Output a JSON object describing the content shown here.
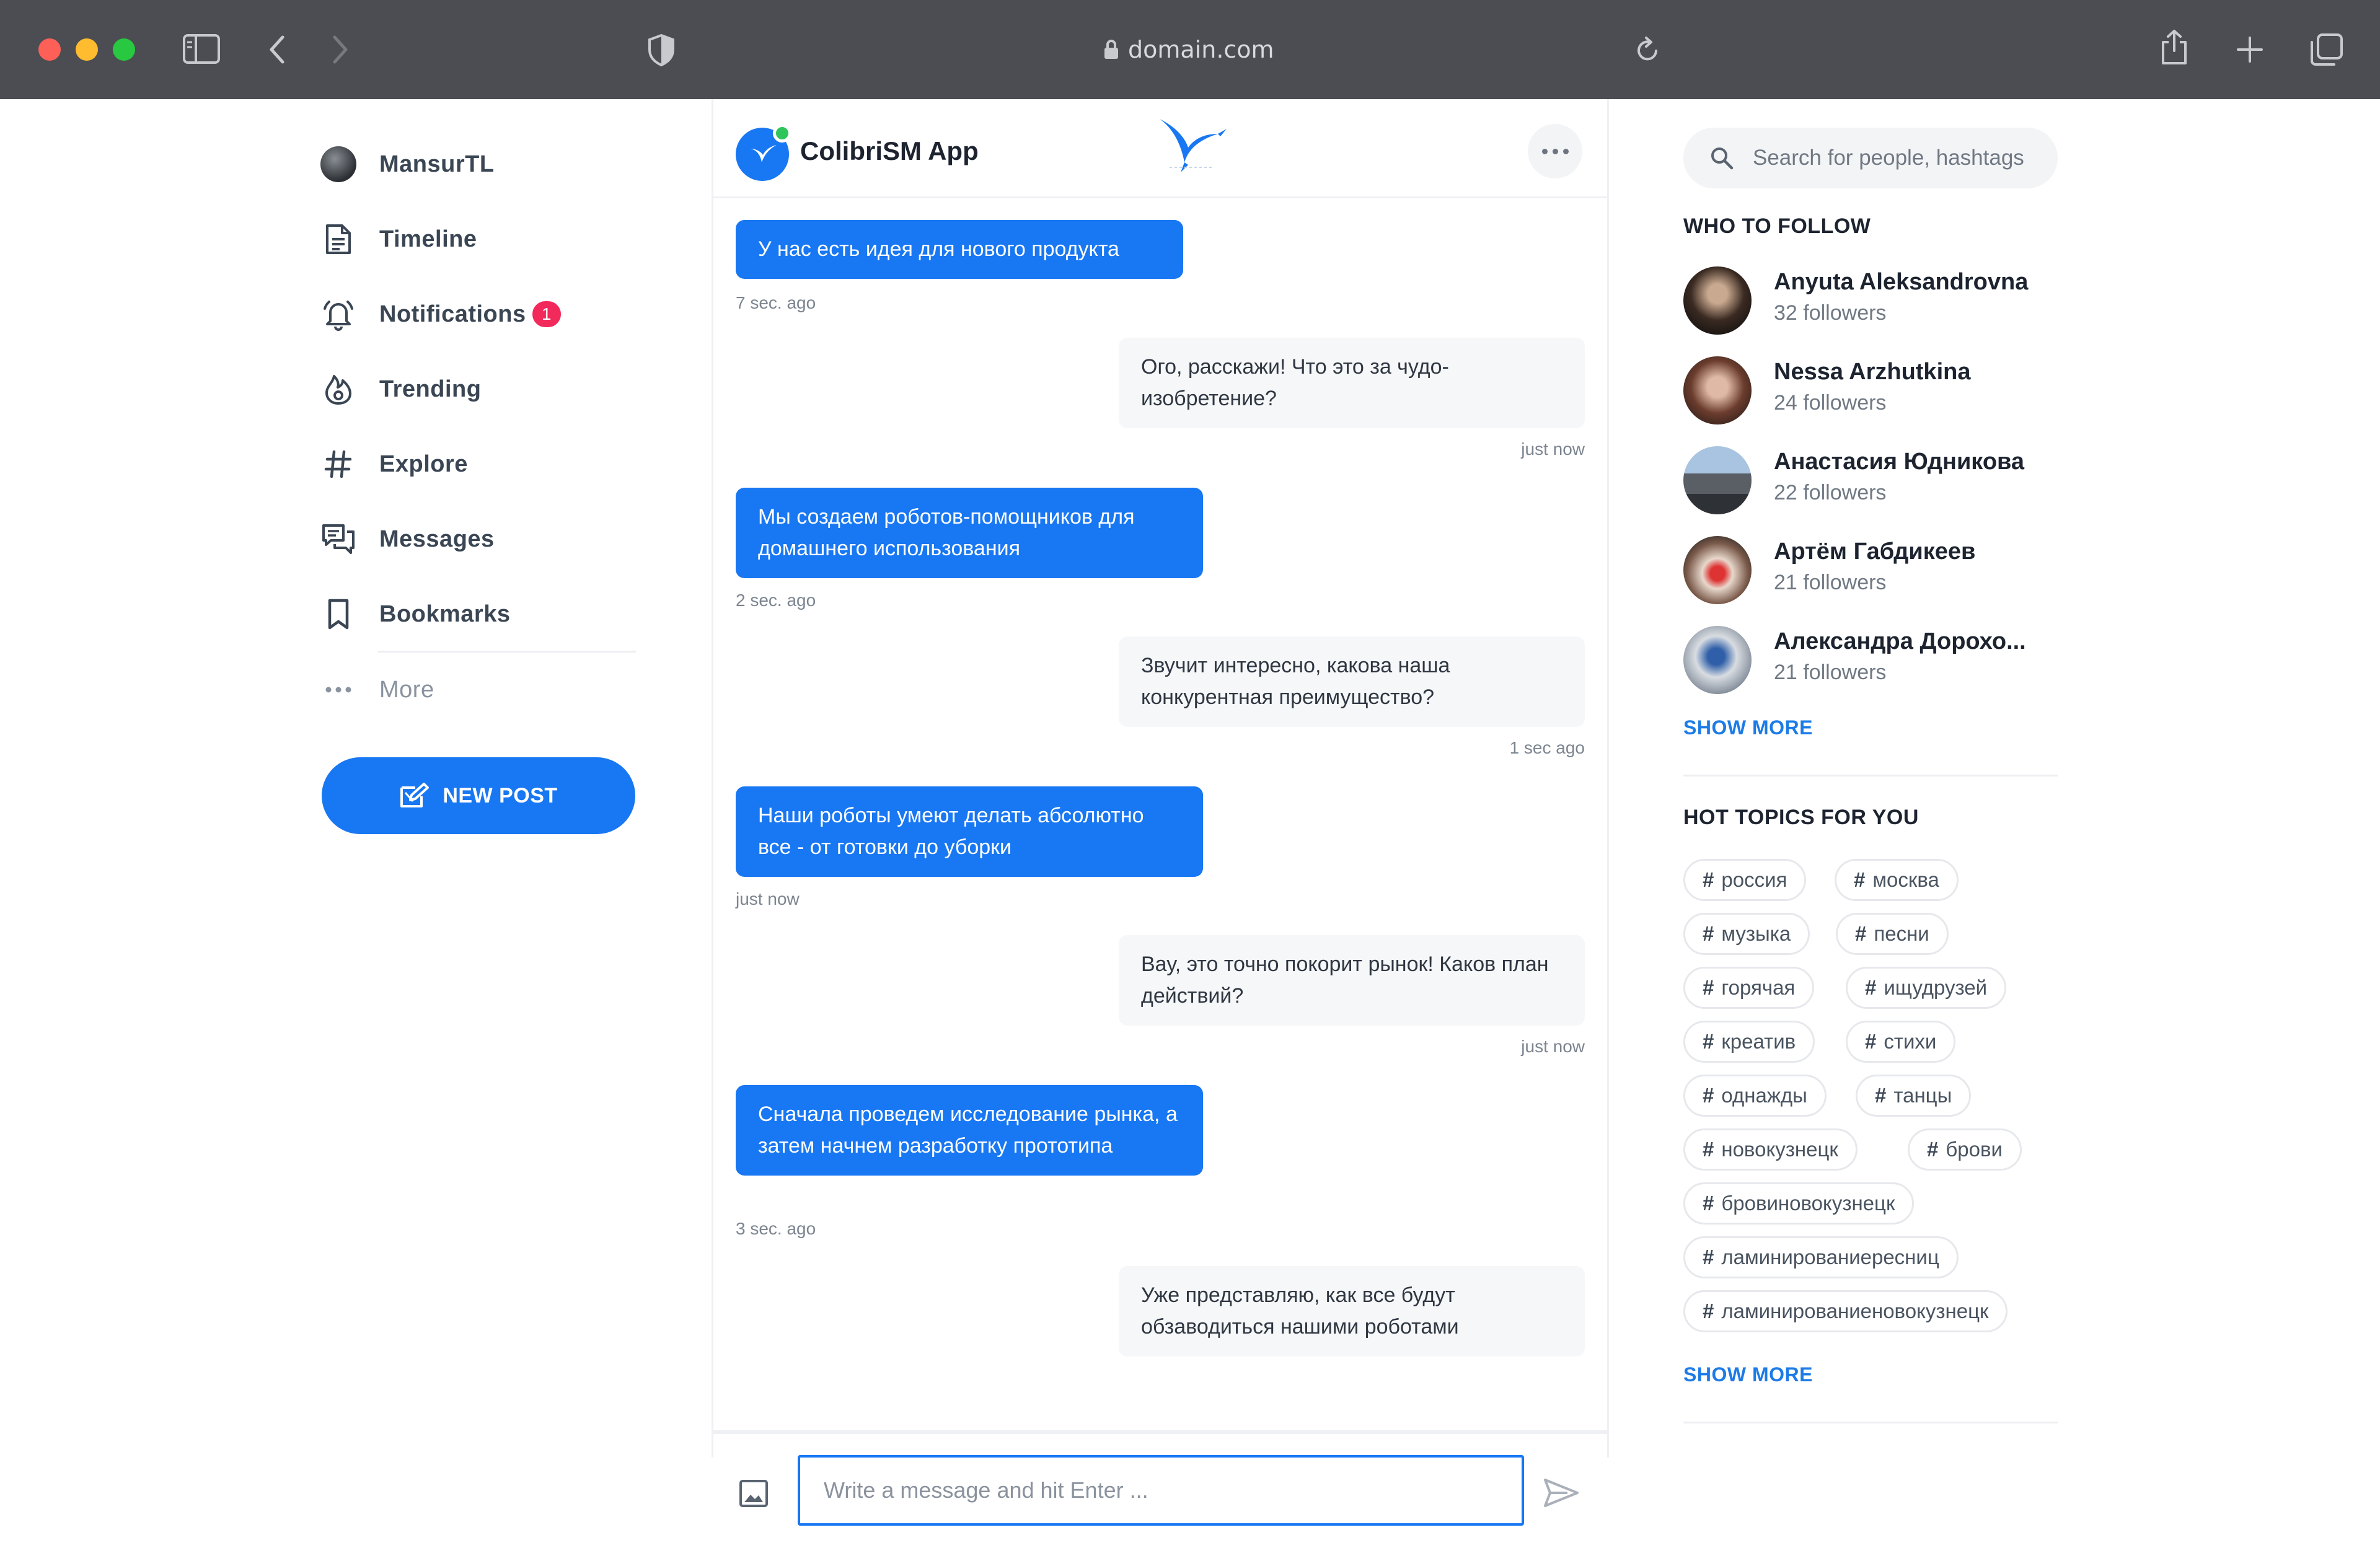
{
  "browser": {
    "url": "domain.com"
  },
  "nav": {
    "user": "MansurTL",
    "items": [
      {
        "label": "Timeline"
      },
      {
        "label": "Notifications",
        "badge": "1"
      },
      {
        "label": "Trending"
      },
      {
        "label": "Explore"
      },
      {
        "label": "Messages"
      },
      {
        "label": "Bookmarks"
      }
    ],
    "more": "More",
    "new_post": "NEW POST"
  },
  "chat": {
    "title": "ColibriSM App",
    "messages": [
      {
        "dir": "in",
        "text": "У нас есть идея для нового продукта",
        "time": "7 sec. ago"
      },
      {
        "dir": "out",
        "text": "Ого, расскажи! Что это за чудо-изобретение?",
        "time": "just now"
      },
      {
        "dir": "in",
        "text": "Мы создаем роботов-помощников для домашнего использования",
        "time": "2 sec. ago"
      },
      {
        "dir": "out",
        "text": "Звучит интересно, какова наша конкурентная преимущество?",
        "time": "1 sec ago"
      },
      {
        "dir": "in",
        "text": "Наши роботы умеют делать абсолютно все - от готовки до уборки",
        "time": "just now"
      },
      {
        "dir": "out",
        "text": "Вау, это точно покорит рынок! Каков план действий?",
        "time": "just now"
      },
      {
        "dir": "in",
        "text": "Сначала проведем исследование рынка, а затем начнем разработку прототипа",
        "time": "3 sec. ago"
      },
      {
        "dir": "out",
        "text": "Уже представляю, как все будут обзаводиться нашими роботами",
        "time": ""
      }
    ],
    "input_placeholder": "Write a message and hit Enter ..."
  },
  "sidebar": {
    "search_placeholder": "Search for people, hashtags",
    "who_to_follow_title": "WHO TO FOLLOW",
    "follow": [
      {
        "name": "Anyuta Aleksandrovna",
        "followers": "32 followers"
      },
      {
        "name": "Nessa Arzhutkina",
        "followers": "24 followers"
      },
      {
        "name": "Анастасия Юдникова",
        "followers": "22 followers"
      },
      {
        "name": "Артём Габдикеев",
        "followers": "21 followers"
      },
      {
        "name": "Александра Дорохо...",
        "followers": "21 followers"
      }
    ],
    "show_more_follow": "SHOW MORE",
    "hot_topics_title": "HOT TOPICS FOR YOU",
    "topics": [
      "россия",
      "москва",
      "музыка",
      "песни",
      "горячая",
      "ищудрузей",
      "креатив",
      "стихи",
      "однажды",
      "танцы",
      "новокузнецк",
      "брови",
      "бровиновокузнецк",
      "ламинированиересниц",
      "ламинированиеновокузнецк"
    ],
    "show_more_topics": "SHOW MORE"
  },
  "colors": {
    "accent": "#1877f2",
    "badge": "#f2295b",
    "online": "#2ec55c"
  }
}
